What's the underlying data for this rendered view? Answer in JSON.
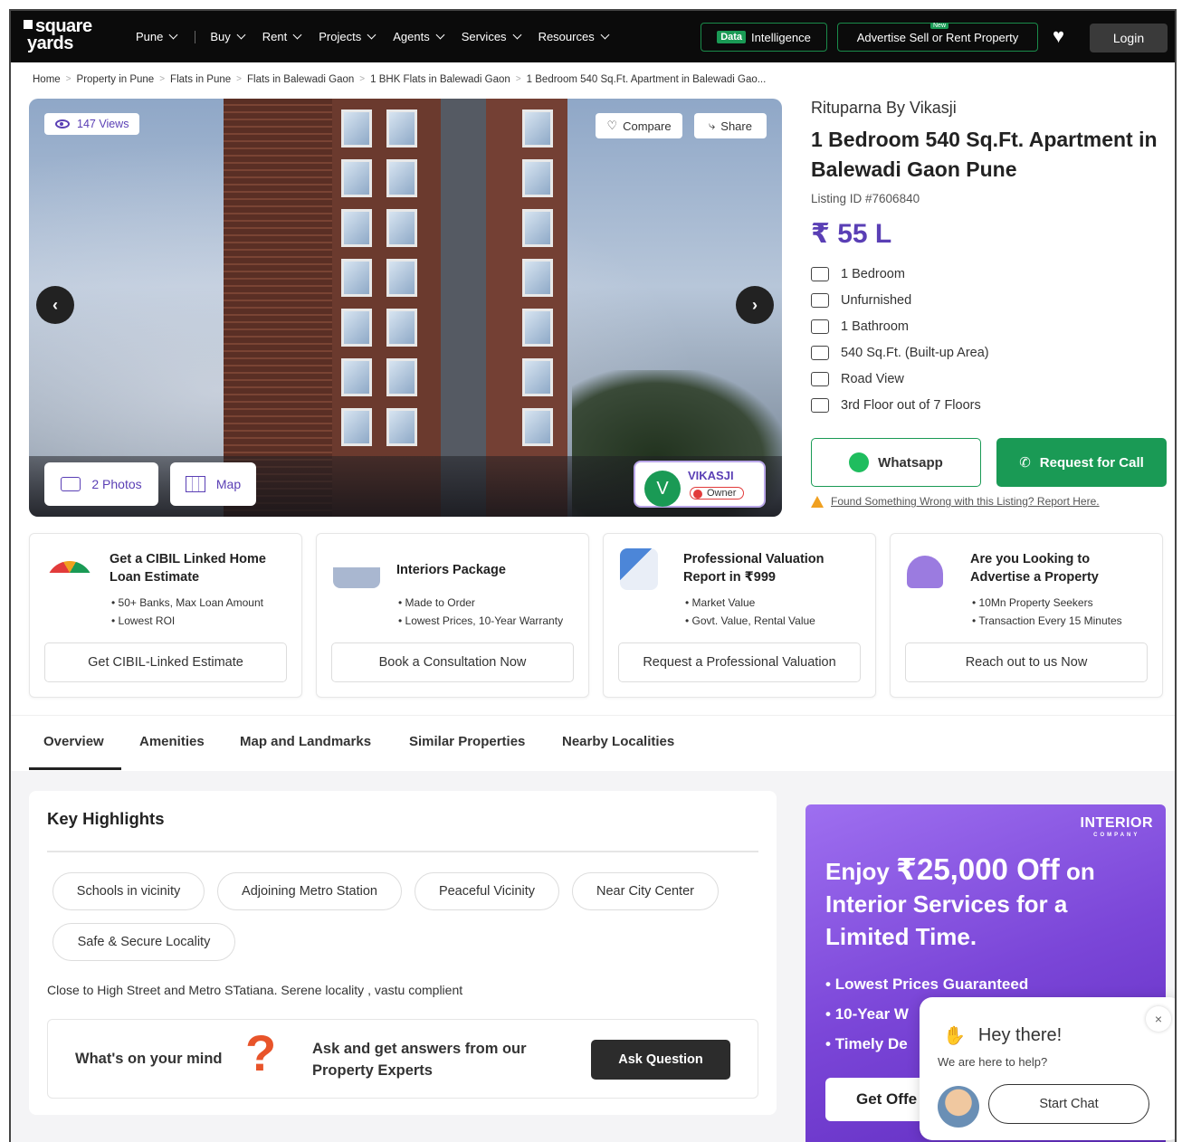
{
  "header": {
    "logo_line1": "square",
    "logo_line2": "yards",
    "nav": [
      "Pune",
      "Buy",
      "Rent",
      "Projects",
      "Agents",
      "Services",
      "Resources"
    ],
    "data_tag": "Data",
    "data_label": "Intelligence",
    "advertise_label": "Advertise  Sell or Rent Property",
    "new_badge": "New",
    "login_label": "Login"
  },
  "breadcrumb": [
    "Home",
    "Property in Pune",
    "Flats in Pune",
    "Flats in Balewadi Gaon",
    "1 BHK Flats in Balewadi Gaon",
    "1 Bedroom 540 Sq.Ft. Apartment in Balewadi Gao..."
  ],
  "gallery": {
    "views": "147 Views",
    "compare_label": "Compare",
    "share_label": "Share",
    "photos_label": "2 Photos",
    "map_label": "Map",
    "owner_initial": "V",
    "owner_name": "VIKASJI",
    "owner_tag": "Owner"
  },
  "listing": {
    "builder": "Rituparna By Vikasji",
    "title": "1 Bedroom 540 Sq.Ft. Apartment in Balewadi Gaon Pune",
    "listing_id": "Listing ID #7606840",
    "price": "₹ 55 L",
    "features": [
      {
        "icon": "bed-icon",
        "text": "1 Bedroom"
      },
      {
        "icon": "sofa-icon",
        "text": "Unfurnished"
      },
      {
        "icon": "bathtub-icon",
        "text": "1 Bathroom"
      },
      {
        "icon": "area-icon",
        "text": "540 Sq.Ft. (Built-up Area)"
      },
      {
        "icon": "road-view-icon",
        "text": "Road View"
      },
      {
        "icon": "floor-icon",
        "text": "3rd Floor out of 7 Floors"
      }
    ],
    "whatsapp_label": "Whatsapp",
    "call_label": "Request for Call",
    "report_label": "Found Something Wrong with this Listing? Report Here."
  },
  "services": [
    {
      "title": "Get a CIBIL Linked Home Loan Estimate",
      "points": [
        "50+ Banks, Max Loan Amount",
        "Lowest ROI"
      ],
      "cta": "Get CIBIL-Linked Estimate",
      "icon": "speedometer-icon"
    },
    {
      "title": "Interiors Package",
      "points": [
        "Made to Order",
        "Lowest Prices, 10-Year Warranty"
      ],
      "cta": "Book a Consultation Now",
      "icon": "sofa-lamp-icon"
    },
    {
      "title": "Professional Valuation Report in ₹999",
      "points": [
        "Market Value",
        "Govt. Value, Rental Value"
      ],
      "cta": "Request a Professional Valuation",
      "icon": "report-chart-icon"
    },
    {
      "title": "Are you Looking to Advertise a Property",
      "points": [
        "10Mn Property Seekers",
        "Transaction Every 15 Minutes"
      ],
      "cta": "Reach out to us Now",
      "icon": "house-megaphone-icon"
    }
  ],
  "tabs": [
    "Overview",
    "Amenities",
    "Map and Landmarks",
    "Similar Properties",
    "Nearby Localities"
  ],
  "highlights": {
    "title": "Key Highlights",
    "chips": [
      "Schools in vicinity",
      "Adjoining Metro Station",
      "Peaceful Vicinity",
      "Near City Center",
      "Safe & Secure Locality"
    ],
    "description": "Close to High Street and Metro STatiana. Serene locality , vastu complient",
    "ask_question": "What's on your mind",
    "ask_text": "Ask and get answers from our Property Experts",
    "ask_button": "Ask Question"
  },
  "ad": {
    "brand": "INTERIOR",
    "brand_sub": "COMPANY",
    "headline_pre": "Enjoy ",
    "headline_amount": "₹25,000 Off",
    "headline_post": " on Interior Services for a Limited Time.",
    "points": [
      "Lowest Prices Guaranteed",
      "10-Year W",
      "Timely De"
    ],
    "button": "Get Offe"
  },
  "chat": {
    "greeting": "Hey there!",
    "sub": "We are here to help?",
    "button": "Start Chat",
    "close": "×"
  },
  "colors": {
    "accent_purple": "#5a3fb5",
    "brand_green": "#1a9a55",
    "header_bg": "#0b0b0b"
  }
}
